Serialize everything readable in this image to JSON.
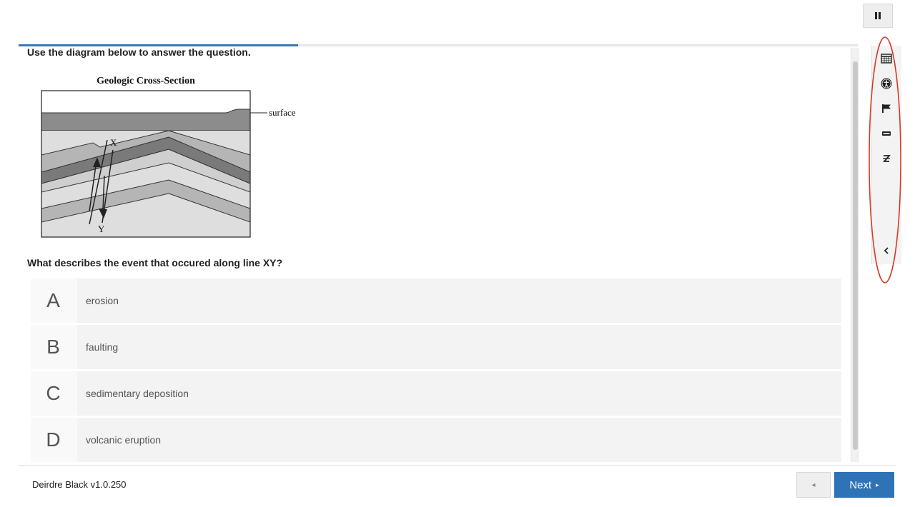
{
  "controls": {
    "pause_icon": "pause-icon"
  },
  "progress": {
    "fraction": 0.333
  },
  "passage": {
    "instructions": "Use the diagram below to answer the question."
  },
  "diagram": {
    "title": "Geologic Cross-Section",
    "surface_label": "surface",
    "point_x_label": "X",
    "point_y_label": "Y"
  },
  "question": {
    "prompt": "What describes the event that occured along line XY?"
  },
  "choices": [
    {
      "letter": "A",
      "text": "erosion"
    },
    {
      "letter": "B",
      "text": "faulting"
    },
    {
      "letter": "C",
      "text": "sedimentary deposition"
    },
    {
      "letter": "D",
      "text": "volcanic eruption"
    }
  ],
  "toolbar": {
    "icons": [
      "calculator-icon",
      "accessibility-icon",
      "flag-icon",
      "line-reader-icon",
      "text-strike-icon",
      "collapse-chevron-icon"
    ],
    "highlight_color": "#d63a24"
  },
  "footer": {
    "user_version": "Deirdre Black v1.0.250",
    "back_arrow": "◂",
    "next_label": "Next",
    "next_arrow": "▸"
  },
  "colors": {
    "accent": "#2f73b7",
    "progress": "#3a78b8"
  }
}
